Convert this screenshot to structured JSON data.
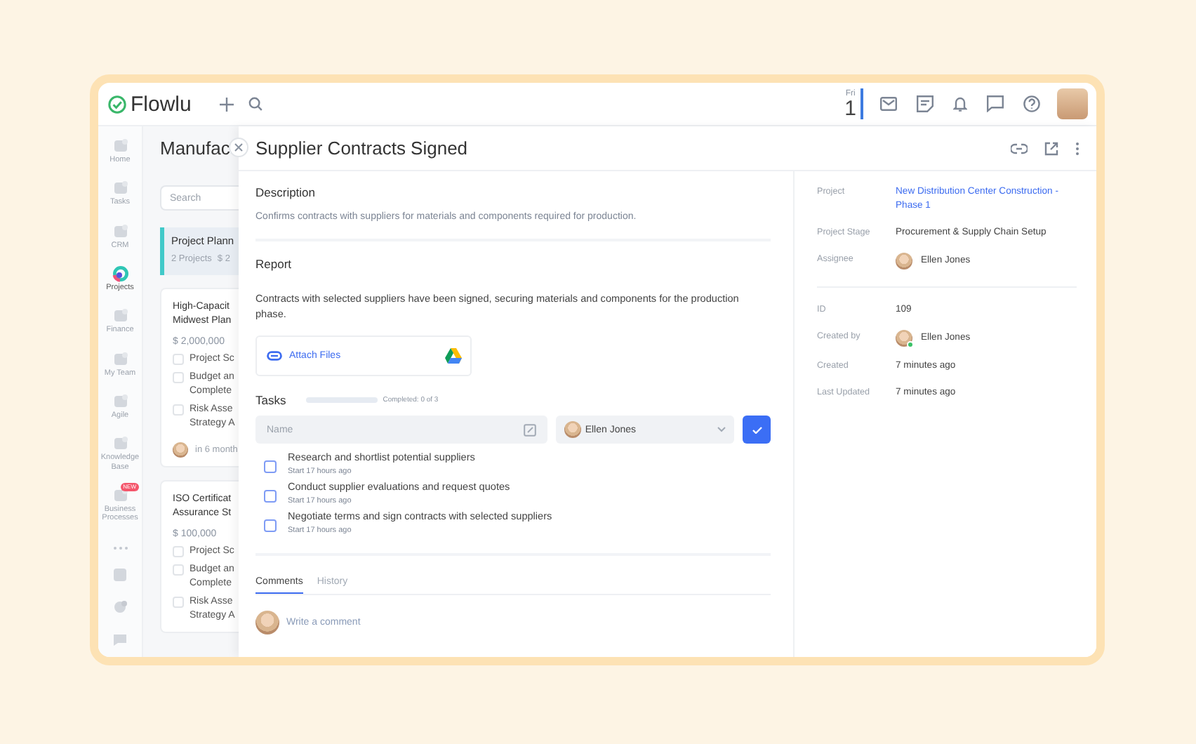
{
  "topbar": {
    "logo": "Flowlu",
    "date": {
      "weekday": "Fri",
      "day": "1"
    }
  },
  "sidebar": {
    "items": [
      {
        "label": "Home",
        "selected": false
      },
      {
        "label": "Tasks",
        "selected": false
      },
      {
        "label": "CRM",
        "selected": false
      },
      {
        "label": "Projects",
        "selected": true
      },
      {
        "label": "Finance",
        "selected": false
      },
      {
        "label": "My Team",
        "selected": false
      },
      {
        "label": "Agile",
        "selected": false
      },
      {
        "label": "Knowledge Base",
        "selected": false
      },
      {
        "label": "Business Processes",
        "selected": false,
        "badge": "NEW"
      }
    ]
  },
  "projects": {
    "title": "Manufac",
    "search": {
      "placeholder": "Search"
    },
    "stage": {
      "name": "Project Plann",
      "count": "2 Projects",
      "amount": "$ 2"
    },
    "cards": [
      {
        "title_lines": [
          "High-Capacit",
          "Midwest Plan"
        ],
        "amount": "$ 2,000,000",
        "checklist": [
          {
            "lines": [
              "Project Sc"
            ],
            "checked": false
          },
          {
            "lines": [
              "Budget an",
              "Complete"
            ],
            "checked": false
          },
          {
            "lines": [
              "Risk Asse",
              "Strategy A"
            ],
            "checked": false
          }
        ],
        "due": "in 6 month"
      },
      {
        "title_lines": [
          "ISO Certificat",
          "Assurance St"
        ],
        "amount": "$ 100,000",
        "checklist": [
          {
            "lines": [
              "Project Sc"
            ],
            "checked": false
          },
          {
            "lines": [
              "Budget an",
              "Complete"
            ],
            "checked": false
          },
          {
            "lines": [
              "Risk Asse",
              "Strategy A"
            ],
            "checked": false
          }
        ]
      }
    ]
  },
  "drawer": {
    "title": "Supplier Contracts Signed",
    "description": {
      "heading": "Description",
      "text": "Confirms contracts with suppliers for materials and components required for production."
    },
    "report": {
      "heading": "Report",
      "text": "Contracts with selected suppliers have been signed, securing materials and components for the production phase."
    },
    "attach": {
      "label": "Attach Files"
    },
    "tasks": {
      "heading": "Tasks",
      "level": 0,
      "progress_text": "Completed: 0 of 3",
      "new_task": {
        "placeholder": "Name",
        "assignee": "Ellen Jones"
      },
      "items": [
        {
          "title": "Research and shortlist potential suppliers",
          "meta": "Start 17 hours ago",
          "checked": false
        },
        {
          "title": "Conduct supplier evaluations and request quotes",
          "meta": "Start 17 hours ago",
          "checked": false
        },
        {
          "title": "Negotiate terms and sign contracts with selected suppliers",
          "meta": "Start 17 hours ago",
          "checked": false
        }
      ]
    },
    "tabs": [
      {
        "label": "Comments",
        "selected": true
      },
      {
        "label": "History",
        "selected": false
      }
    ],
    "comment": {
      "placeholder": "Write a comment"
    }
  },
  "details": {
    "groups": [
      [
        {
          "label": "Project",
          "value": "New Distribution Center Construction - Phase 1",
          "kind": "link"
        },
        {
          "label": "Project Stage",
          "value": "Procurement & Supply Chain Setup",
          "kind": "text"
        },
        {
          "label": "Assignee",
          "value": "Ellen Jones",
          "kind": "person",
          "online": false
        }
      ],
      [
        {
          "label": "ID",
          "value": "109",
          "kind": "text"
        },
        {
          "label": "Created by",
          "value": "Ellen Jones",
          "kind": "person",
          "online": true
        },
        {
          "label": "Created",
          "value": "7 minutes ago",
          "kind": "text"
        },
        {
          "label": "Last Updated",
          "value": "7 minutes ago",
          "kind": "text"
        }
      ]
    ]
  }
}
